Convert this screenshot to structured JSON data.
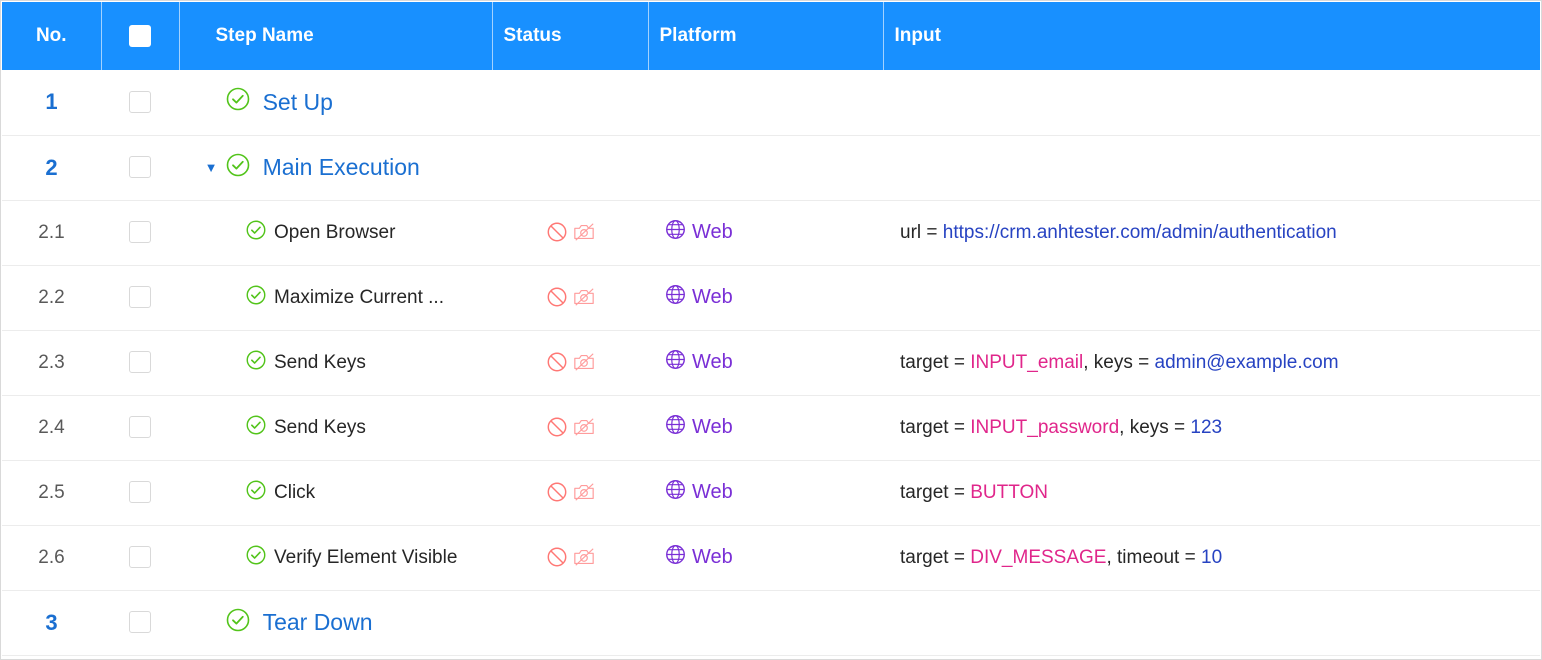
{
  "header": {
    "no": "No.",
    "step_name": "Step Name",
    "status": "Status",
    "platform": "Platform",
    "input": "Input"
  },
  "icons": {
    "step_ok": "check-circle-icon",
    "disabled": "ban-icon",
    "no_screenshot": "camera-off-icon",
    "web": "globe-icon",
    "expand": "caret-down-icon"
  },
  "colors": {
    "header_bg": "#1890ff",
    "group_text": "#1a6fd1",
    "ok_green": "#52c41a",
    "status_red": "#ff7875",
    "platform_purple": "#7a2fd6",
    "value_blue": "#2743c2",
    "target_pink": "#e0268b"
  },
  "groups": [
    {
      "no": "1",
      "name": "Set Up"
    },
    {
      "no": "2",
      "name": "Main Execution"
    },
    {
      "no": "3",
      "name": "Tear Down"
    }
  ],
  "steps": [
    {
      "no": "2.1",
      "name": "Open Browser",
      "platform": "Web",
      "input": [
        {
          "k": "url = ",
          "v": "https://crm.anhtester.com/admin/authentication"
        }
      ]
    },
    {
      "no": "2.2",
      "name": "Maximize Current ...",
      "platform": "Web",
      "input": []
    },
    {
      "no": "2.3",
      "name": "Send Keys",
      "platform": "Web",
      "input": [
        {
          "k": "target = ",
          "v": "INPUT_email"
        },
        {
          "k": ", keys = ",
          "v": "admin@example.com"
        }
      ]
    },
    {
      "no": "2.4",
      "name": "Send Keys",
      "platform": "Web",
      "input": [
        {
          "k": "target = ",
          "v": "INPUT_password"
        },
        {
          "k": ", keys = ",
          "v": "123"
        }
      ]
    },
    {
      "no": "2.5",
      "name": "Click",
      "platform": "Web",
      "input": [
        {
          "k": "target = ",
          "v": "BUTTON"
        }
      ]
    },
    {
      "no": "2.6",
      "name": "Verify Element Visible",
      "platform": "Web",
      "input": [
        {
          "k": "target = ",
          "v": "DIV_MESSAGE"
        },
        {
          "k": ", timeout = ",
          "v": "10"
        }
      ]
    }
  ]
}
